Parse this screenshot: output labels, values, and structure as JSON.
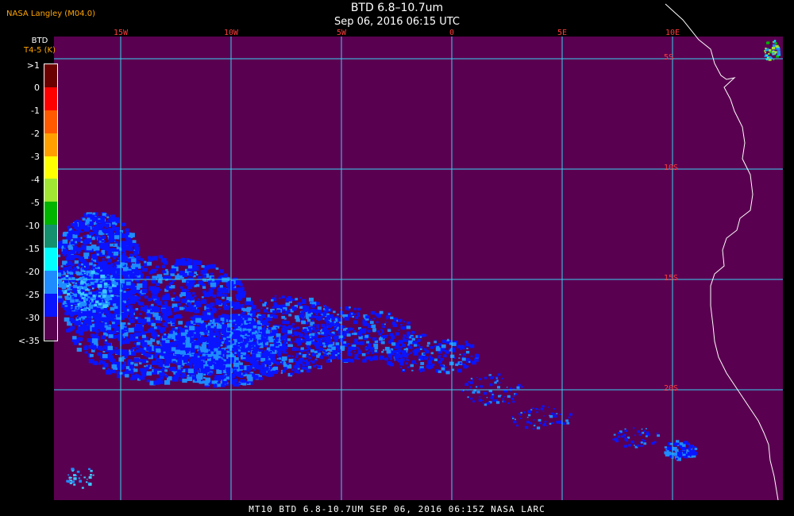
{
  "header": {
    "producer": "NASA Langley (M04.0)",
    "title": "BTD 6.8–10.7um",
    "subtitle": "Sep 06, 2016 06:15 UTC"
  },
  "colorbar": {
    "title": "BTD",
    "units": "T4-5 (K)",
    "labels": [
      ">1",
      "0",
      "-1",
      "-2",
      "-3",
      "-4",
      "-5",
      "-10",
      "-15",
      "-20",
      "-25",
      "-30",
      "<-35"
    ],
    "colors": [
      "#6b0000",
      "#ff0000",
      "#ff5a00",
      "#ffa000",
      "#ffff00",
      "#a0e632",
      "#00b400",
      "#14906e",
      "#00ffff",
      "#1e8cff",
      "#0a14ff",
      "#5a0050"
    ]
  },
  "grid": {
    "longitudes": [
      "15W",
      "10W",
      "5W",
      "0",
      "5E",
      "10E"
    ],
    "latitudes": [
      "5S",
      "10S",
      "15S",
      "20S"
    ]
  },
  "footer": "MT10  BTD 6.8-10.7UM   SEP 06, 2016 06:15Z   NASA LARC",
  "colors": {
    "background": "#5a0050",
    "grid": "#35d3f0",
    "coast": "#ffffff",
    "labels_red": "#ff3b3b"
  }
}
